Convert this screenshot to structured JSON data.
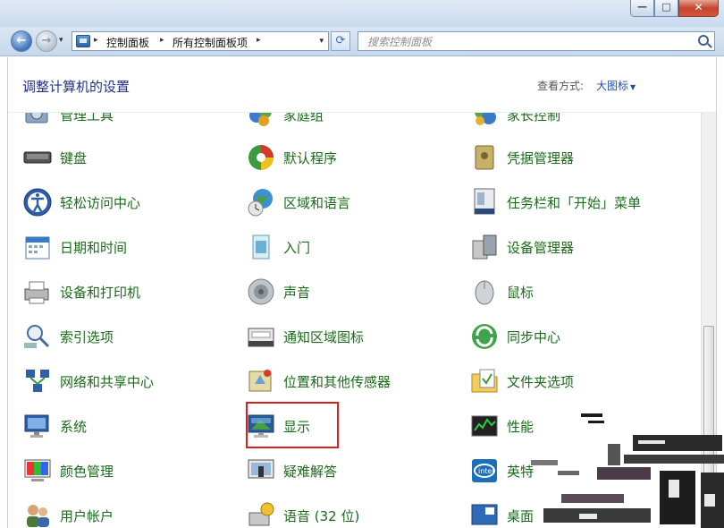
{
  "window": {
    "minimize_glyph": "—",
    "maximize_glyph": "□",
    "close_glyph": "✕"
  },
  "nav": {
    "back_glyph": "←",
    "forward_glyph": "→",
    "dropdown_glyph": "▾",
    "breadcrumb": [
      "控制面板",
      "所有控制面板项"
    ],
    "separator_glyph": "▸",
    "refresh_glyph": "⟳",
    "search_placeholder": "搜索控制面板"
  },
  "header": {
    "title": "调整计算机的设置",
    "view_by_label": "查看方式:",
    "view_by_value": "大图标"
  },
  "items": [
    {
      "label": "管理工具",
      "icon": "admin-tools-icon"
    },
    {
      "label": "家庭组",
      "icon": "homegroup-icon"
    },
    {
      "label": "家长控制",
      "icon": "parental-controls-icon"
    },
    {
      "label": "键盘",
      "icon": "keyboard-icon"
    },
    {
      "label": "默认程序",
      "icon": "default-programs-icon"
    },
    {
      "label": "凭据管理器",
      "icon": "credential-manager-icon"
    },
    {
      "label": "轻松访问中心",
      "icon": "ease-of-access-icon"
    },
    {
      "label": "区域和语言",
      "icon": "region-language-icon"
    },
    {
      "label": "任务栏和「开始」菜单",
      "icon": "taskbar-icon"
    },
    {
      "label": "日期和时间",
      "icon": "date-time-icon"
    },
    {
      "label": "入门",
      "icon": "getting-started-icon"
    },
    {
      "label": "设备管理器",
      "icon": "device-manager-icon"
    },
    {
      "label": "设备和打印机",
      "icon": "printer-icon"
    },
    {
      "label": "声音",
      "icon": "sound-icon"
    },
    {
      "label": "鼠标",
      "icon": "mouse-icon"
    },
    {
      "label": "索引选项",
      "icon": "indexing-icon"
    },
    {
      "label": "通知区域图标",
      "icon": "notification-icons-icon"
    },
    {
      "label": "同步中心",
      "icon": "sync-center-icon"
    },
    {
      "label": "网络和共享中心",
      "icon": "network-icon"
    },
    {
      "label": "位置和其他传感器",
      "icon": "location-sensor-icon"
    },
    {
      "label": "文件夹选项",
      "icon": "folder-options-icon"
    },
    {
      "label": "系统",
      "icon": "system-icon"
    },
    {
      "label": "显示",
      "icon": "display-icon"
    },
    {
      "label": "性能",
      "icon": "performance-icon"
    },
    {
      "label": "颜色管理",
      "icon": "color-management-icon"
    },
    {
      "label": "疑难解答",
      "icon": "troubleshooting-icon"
    },
    {
      "label": "英特",
      "icon": "intel-graphics-icon"
    },
    {
      "label": "用户帐户",
      "icon": "user-accounts-icon"
    },
    {
      "label": "语音 (32 位)",
      "icon": "speech-icon"
    },
    {
      "label": "桌面",
      "icon": "desktop-gadgets-icon"
    }
  ]
}
